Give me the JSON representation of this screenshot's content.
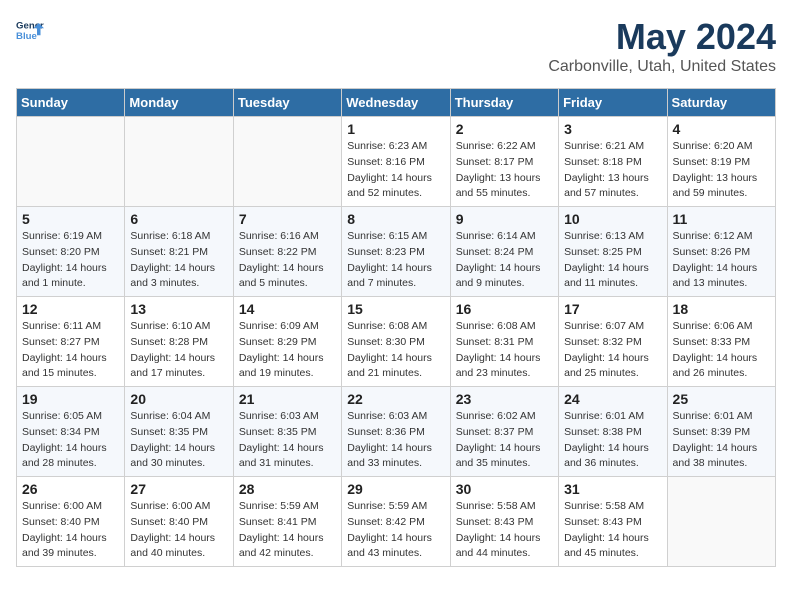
{
  "header": {
    "logo_line1": "General",
    "logo_line2": "Blue",
    "month_year": "May 2024",
    "location": "Carbonville, Utah, United States"
  },
  "weekdays": [
    "Sunday",
    "Monday",
    "Tuesday",
    "Wednesday",
    "Thursday",
    "Friday",
    "Saturday"
  ],
  "weeks": [
    [
      {
        "day": "",
        "sunrise": "",
        "sunset": "",
        "daylight": ""
      },
      {
        "day": "",
        "sunrise": "",
        "sunset": "",
        "daylight": ""
      },
      {
        "day": "",
        "sunrise": "",
        "sunset": "",
        "daylight": ""
      },
      {
        "day": "1",
        "sunrise": "Sunrise: 6:23 AM",
        "sunset": "Sunset: 8:16 PM",
        "daylight": "Daylight: 14 hours and 52 minutes."
      },
      {
        "day": "2",
        "sunrise": "Sunrise: 6:22 AM",
        "sunset": "Sunset: 8:17 PM",
        "daylight": "Daylight: 13 hours and 55 minutes."
      },
      {
        "day": "3",
        "sunrise": "Sunrise: 6:21 AM",
        "sunset": "Sunset: 8:18 PM",
        "daylight": "Daylight: 13 hours and 57 minutes."
      },
      {
        "day": "4",
        "sunrise": "Sunrise: 6:20 AM",
        "sunset": "Sunset: 8:19 PM",
        "daylight": "Daylight: 13 hours and 59 minutes."
      }
    ],
    [
      {
        "day": "5",
        "sunrise": "Sunrise: 6:19 AM",
        "sunset": "Sunset: 8:20 PM",
        "daylight": "Daylight: 14 hours and 1 minute."
      },
      {
        "day": "6",
        "sunrise": "Sunrise: 6:18 AM",
        "sunset": "Sunset: 8:21 PM",
        "daylight": "Daylight: 14 hours and 3 minutes."
      },
      {
        "day": "7",
        "sunrise": "Sunrise: 6:16 AM",
        "sunset": "Sunset: 8:22 PM",
        "daylight": "Daylight: 14 hours and 5 minutes."
      },
      {
        "day": "8",
        "sunrise": "Sunrise: 6:15 AM",
        "sunset": "Sunset: 8:23 PM",
        "daylight": "Daylight: 14 hours and 7 minutes."
      },
      {
        "day": "9",
        "sunrise": "Sunrise: 6:14 AM",
        "sunset": "Sunset: 8:24 PM",
        "daylight": "Daylight: 14 hours and 9 minutes."
      },
      {
        "day": "10",
        "sunrise": "Sunrise: 6:13 AM",
        "sunset": "Sunset: 8:25 PM",
        "daylight": "Daylight: 14 hours and 11 minutes."
      },
      {
        "day": "11",
        "sunrise": "Sunrise: 6:12 AM",
        "sunset": "Sunset: 8:26 PM",
        "daylight": "Daylight: 14 hours and 13 minutes."
      }
    ],
    [
      {
        "day": "12",
        "sunrise": "Sunrise: 6:11 AM",
        "sunset": "Sunset: 8:27 PM",
        "daylight": "Daylight: 14 hours and 15 minutes."
      },
      {
        "day": "13",
        "sunrise": "Sunrise: 6:10 AM",
        "sunset": "Sunset: 8:28 PM",
        "daylight": "Daylight: 14 hours and 17 minutes."
      },
      {
        "day": "14",
        "sunrise": "Sunrise: 6:09 AM",
        "sunset": "Sunset: 8:29 PM",
        "daylight": "Daylight: 14 hours and 19 minutes."
      },
      {
        "day": "15",
        "sunrise": "Sunrise: 6:08 AM",
        "sunset": "Sunset: 8:30 PM",
        "daylight": "Daylight: 14 hours and 21 minutes."
      },
      {
        "day": "16",
        "sunrise": "Sunrise: 6:08 AM",
        "sunset": "Sunset: 8:31 PM",
        "daylight": "Daylight: 14 hours and 23 minutes."
      },
      {
        "day": "17",
        "sunrise": "Sunrise: 6:07 AM",
        "sunset": "Sunset: 8:32 PM",
        "daylight": "Daylight: 14 hours and 25 minutes."
      },
      {
        "day": "18",
        "sunrise": "Sunrise: 6:06 AM",
        "sunset": "Sunset: 8:33 PM",
        "daylight": "Daylight: 14 hours and 26 minutes."
      }
    ],
    [
      {
        "day": "19",
        "sunrise": "Sunrise: 6:05 AM",
        "sunset": "Sunset: 8:34 PM",
        "daylight": "Daylight: 14 hours and 28 minutes."
      },
      {
        "day": "20",
        "sunrise": "Sunrise: 6:04 AM",
        "sunset": "Sunset: 8:35 PM",
        "daylight": "Daylight: 14 hours and 30 minutes."
      },
      {
        "day": "21",
        "sunrise": "Sunrise: 6:03 AM",
        "sunset": "Sunset: 8:35 PM",
        "daylight": "Daylight: 14 hours and 31 minutes."
      },
      {
        "day": "22",
        "sunrise": "Sunrise: 6:03 AM",
        "sunset": "Sunset: 8:36 PM",
        "daylight": "Daylight: 14 hours and 33 minutes."
      },
      {
        "day": "23",
        "sunrise": "Sunrise: 6:02 AM",
        "sunset": "Sunset: 8:37 PM",
        "daylight": "Daylight: 14 hours and 35 minutes."
      },
      {
        "day": "24",
        "sunrise": "Sunrise: 6:01 AM",
        "sunset": "Sunset: 8:38 PM",
        "daylight": "Daylight: 14 hours and 36 minutes."
      },
      {
        "day": "25",
        "sunrise": "Sunrise: 6:01 AM",
        "sunset": "Sunset: 8:39 PM",
        "daylight": "Daylight: 14 hours and 38 minutes."
      }
    ],
    [
      {
        "day": "26",
        "sunrise": "Sunrise: 6:00 AM",
        "sunset": "Sunset: 8:40 PM",
        "daylight": "Daylight: 14 hours and 39 minutes."
      },
      {
        "day": "27",
        "sunrise": "Sunrise: 6:00 AM",
        "sunset": "Sunset: 8:40 PM",
        "daylight": "Daylight: 14 hours and 40 minutes."
      },
      {
        "day": "28",
        "sunrise": "Sunrise: 5:59 AM",
        "sunset": "Sunset: 8:41 PM",
        "daylight": "Daylight: 14 hours and 42 minutes."
      },
      {
        "day": "29",
        "sunrise": "Sunrise: 5:59 AM",
        "sunset": "Sunset: 8:42 PM",
        "daylight": "Daylight: 14 hours and 43 minutes."
      },
      {
        "day": "30",
        "sunrise": "Sunrise: 5:58 AM",
        "sunset": "Sunset: 8:43 PM",
        "daylight": "Daylight: 14 hours and 44 minutes."
      },
      {
        "day": "31",
        "sunrise": "Sunrise: 5:58 AM",
        "sunset": "Sunset: 8:43 PM",
        "daylight": "Daylight: 14 hours and 45 minutes."
      },
      {
        "day": "",
        "sunrise": "",
        "sunset": "",
        "daylight": ""
      }
    ]
  ]
}
